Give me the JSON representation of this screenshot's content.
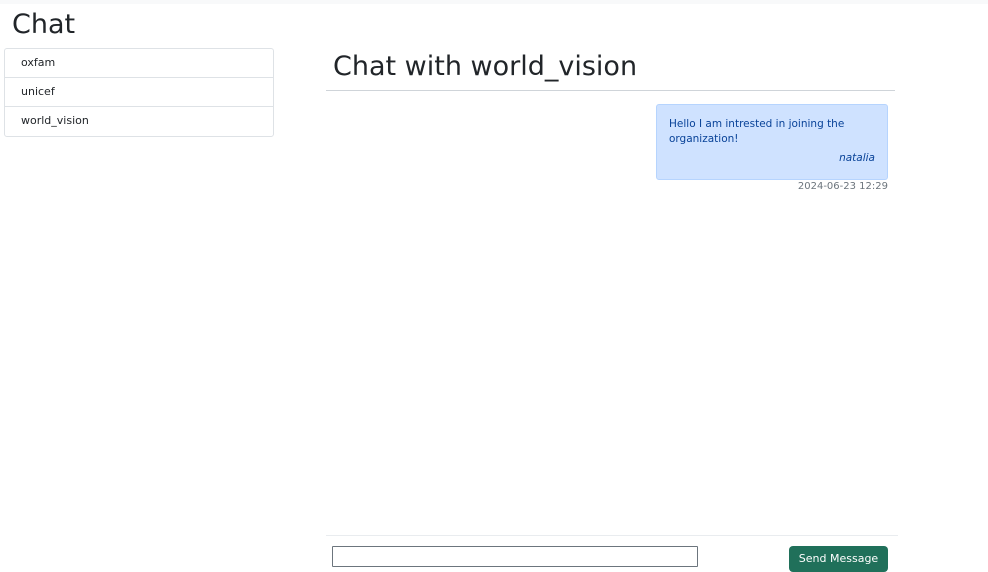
{
  "page": {
    "title": "Chat"
  },
  "contacts": [
    {
      "label": "oxfam"
    },
    {
      "label": "unicef"
    },
    {
      "label": "world_vision"
    }
  ],
  "chat": {
    "title": "Chat with world_vision",
    "messages": [
      {
        "text": "Hello I am intrested in joining the organization!",
        "sender": "natalia",
        "timestamp": "2024-06-23 12:29"
      }
    ]
  },
  "composer": {
    "input_value": "",
    "send_label": "Send Message"
  },
  "colors": {
    "bubble_bg": "#cfe2ff",
    "bubble_text": "#084298",
    "send_button": "#20705a"
  }
}
